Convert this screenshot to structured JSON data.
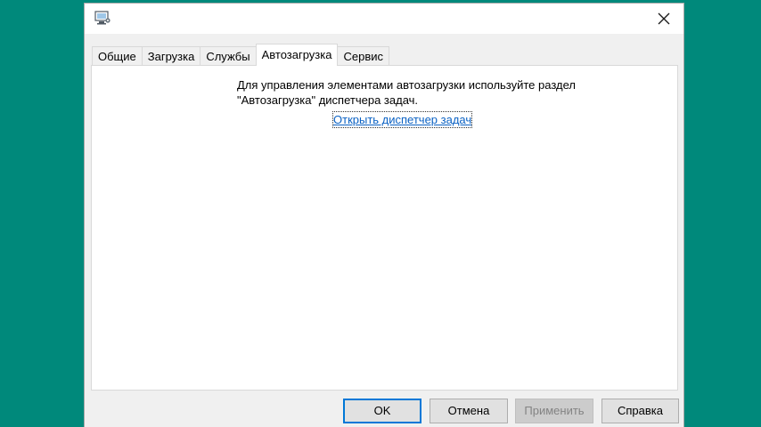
{
  "window": {
    "close_glyph": "✕"
  },
  "tabs": [
    {
      "label": "Общие"
    },
    {
      "label": "Загрузка"
    },
    {
      "label": "Службы"
    },
    {
      "label": "Автозагрузка",
      "active": true
    },
    {
      "label": "Сервис"
    }
  ],
  "panel": {
    "info_text": "Для управления элементами автозагрузки используйте раздел\n\"Автозагрузка\" диспетчера задач.",
    "link_label": "Открыть диспетчер задач"
  },
  "buttons": {
    "ok": "OK",
    "cancel": "Отмена",
    "apply": "Применить",
    "help": "Справка"
  },
  "colors": {
    "background": "#00897b",
    "link": "#0b62c4",
    "default_button_border": "#0078d7"
  },
  "icons": {
    "app": "system-configuration-icon",
    "close": "close-icon"
  }
}
